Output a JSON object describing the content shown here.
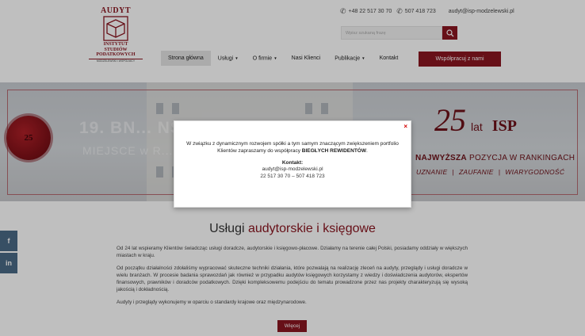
{
  "logo": {
    "brand": "AUDYT",
    "line1": "INSTYTUT",
    "line2": "STUDIÓW",
    "line3": "PODATKOWYCH",
    "subline": "MODZELEWSKI I WSPÓLNICY"
  },
  "contacts": {
    "phone1": "+48 22 517 30 70",
    "phone2": "507 418 723",
    "email": "audyt@isp-modzelewski.pl",
    "phone_icon": "phone-icon"
  },
  "search": {
    "placeholder": "Wpisz szukaną frazę",
    "icon": "search-icon"
  },
  "nav": {
    "home": "Strona główna",
    "services": "Usługi",
    "about": "O firmie",
    "clients": "Nasi Klienci",
    "publications": "Publikacje",
    "contact": "Kontakt",
    "cta": "Współpracuj z nami"
  },
  "hero": {
    "number_big": "19.",
    "overlay_line1": "19. BN... NSOWYCH",
    "overlay_line2": "MIEJSCE w R... nki 2021",
    "seal_number": "25",
    "anniv_number": "25",
    "anniv_unit": "lat",
    "anniv_brand": "ISP",
    "rank_bold": "NAJWYŻSZA",
    "rank_rest": " POZYCJA W RANKINGACH",
    "value1": "UZNANIE",
    "value2": "ZAUFANIE",
    "value3": "WIARYGODNOŚĆ"
  },
  "modal": {
    "close": "×",
    "message_start": "W związku z dynamicznym rozwojem spółki a tym samym znaczącym zwiększeniem portfolio Klientów zapraszamy do współpracy ",
    "message_bold": "BIEGŁYCH REWIDENTÓW",
    "message_end": ".",
    "contact_label": "Kontakt:",
    "email": "audyt@isp-modzelewski.pl",
    "phones": "22 517 30 70   – 507 418 723"
  },
  "content": {
    "heading_plain": "Usługi ",
    "heading_accent": "audytorskie i księgowe",
    "p1": "Od 24 lat wspieramy Klientów świadcząc usługi doradcze, audytorskie i księgowo-płacowe. Działamy na terenie całej Polski, posiadamy oddziały w większych miastach w kraju.",
    "p2": "Od początku działalności zdołaliśmy wypracować skuteczne techniki działania, które pozwalają na realizację zleceń na audyty, przeglądy i usługi doradcze w wielu branżach. W procesie badania sprawozdań jak również w przypadku audytów księgowych korzystamy z wiedzy i doświadczenia audytorów, ekspertów finansowych, prawników i doradców podatkowych. Dzięki kompleksowemu podejściu do tematu prowadzone przez nas projekty charakteryzują się wysoką jakością i dokładnością.",
    "p3": "Audyty i przeglądy wykonujemy w oparciu o standardy krajowe oraz międzynarodowe.",
    "more": "Więcej"
  },
  "social": {
    "facebook": "f",
    "linkedin": "in"
  },
  "colors": {
    "brand": "#8a1620",
    "social": "#4a6a86"
  }
}
